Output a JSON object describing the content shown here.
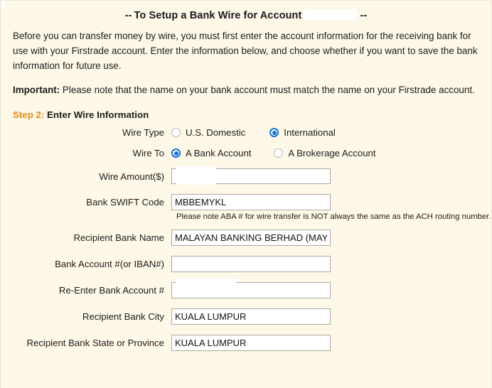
{
  "header": {
    "title_prefix": "--",
    "title_text": "To Setup a Bank Wire for Account",
    "title_suffix": "--",
    "account_redacted": ""
  },
  "intro": {
    "paragraph": "Before you can transfer money by wire, you must first enter the account information for the receiving bank for use with your Firstrade account. Enter the information below, and choose whether if you want to save the bank information for future use.",
    "important_label": "Important:",
    "important_text": " Please note that the name on your bank account must match the name on your Firstrade account."
  },
  "step": {
    "number_label": "Step 2:",
    "title": " Enter Wire Information"
  },
  "form": {
    "wire_type": {
      "label": "Wire Type",
      "options": [
        {
          "label": "U.S. Domestic",
          "selected": false
        },
        {
          "label": "International",
          "selected": true
        }
      ]
    },
    "wire_to": {
      "label": "Wire To",
      "options": [
        {
          "label": "A Bank Account",
          "selected": true
        },
        {
          "label": "A Brokerage Account",
          "selected": false
        }
      ]
    },
    "fields": [
      {
        "label": "Wire Amount($)",
        "value": "",
        "placeholder": "",
        "redacted": true
      },
      {
        "label": "Bank SWIFT Code",
        "value": "MBBEMYKL",
        "placeholder": "",
        "redacted": false
      },
      {
        "label": "Recipient Bank Name",
        "value": "MALAYAN BANKING BERHAD (MAYBANK)",
        "placeholder": "",
        "redacted": false
      },
      {
        "label": "Bank Account #(or IBAN#)",
        "value": "",
        "placeholder": "",
        "redacted": false
      },
      {
        "label": "Re-Enter Bank Account #",
        "value": "",
        "placeholder": "",
        "redacted": true
      },
      {
        "label": "Recipient Bank City",
        "value": "KUALA LUMPUR",
        "placeholder": "",
        "redacted": false
      },
      {
        "label": "Recipient Bank State or Province",
        "value": "KUALA LUMPUR",
        "placeholder": "",
        "redacted": false
      }
    ],
    "swift_hint": "Please note ABA # for wire transfer is NOT always the same as the ACH routing number."
  },
  "colors": {
    "background": "#fdf8e7",
    "accent_orange": "#e08a1e",
    "radio_blue": "#1673d6",
    "text": "#1c1c1c",
    "field_border": "#aaaaa0"
  }
}
